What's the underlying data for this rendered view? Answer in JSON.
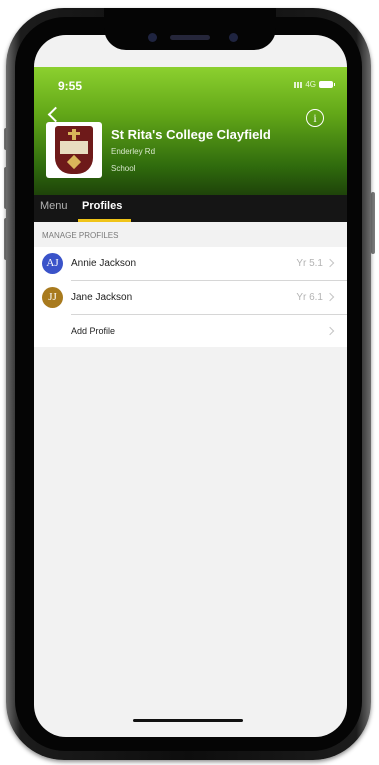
{
  "status_bar": {
    "time": "9:55",
    "network": "4G"
  },
  "school": {
    "name": "St Rita's College Clayfield",
    "address": "Enderley Rd",
    "type": "School"
  },
  "tabs": [
    {
      "label": "Menu",
      "active": false
    },
    {
      "label": "Profiles",
      "active": true
    }
  ],
  "colors": {
    "accent": "#f0c419",
    "header_green": "#63a818"
  },
  "section_title": "MANAGE PROFILES",
  "profiles": [
    {
      "initials": "AJ",
      "name": "Annie Jackson",
      "year": "Yr 5.1",
      "avatar_color": "#3a53c9"
    },
    {
      "initials": "JJ",
      "name": "Jane Jackson",
      "year": "Yr 6.1",
      "avatar_color": "#a87a1e"
    }
  ],
  "add_profile_label": "Add Profile",
  "icons": {
    "back": "chevron-left-icon",
    "info": "info-icon",
    "row": "chevron-right-icon"
  }
}
